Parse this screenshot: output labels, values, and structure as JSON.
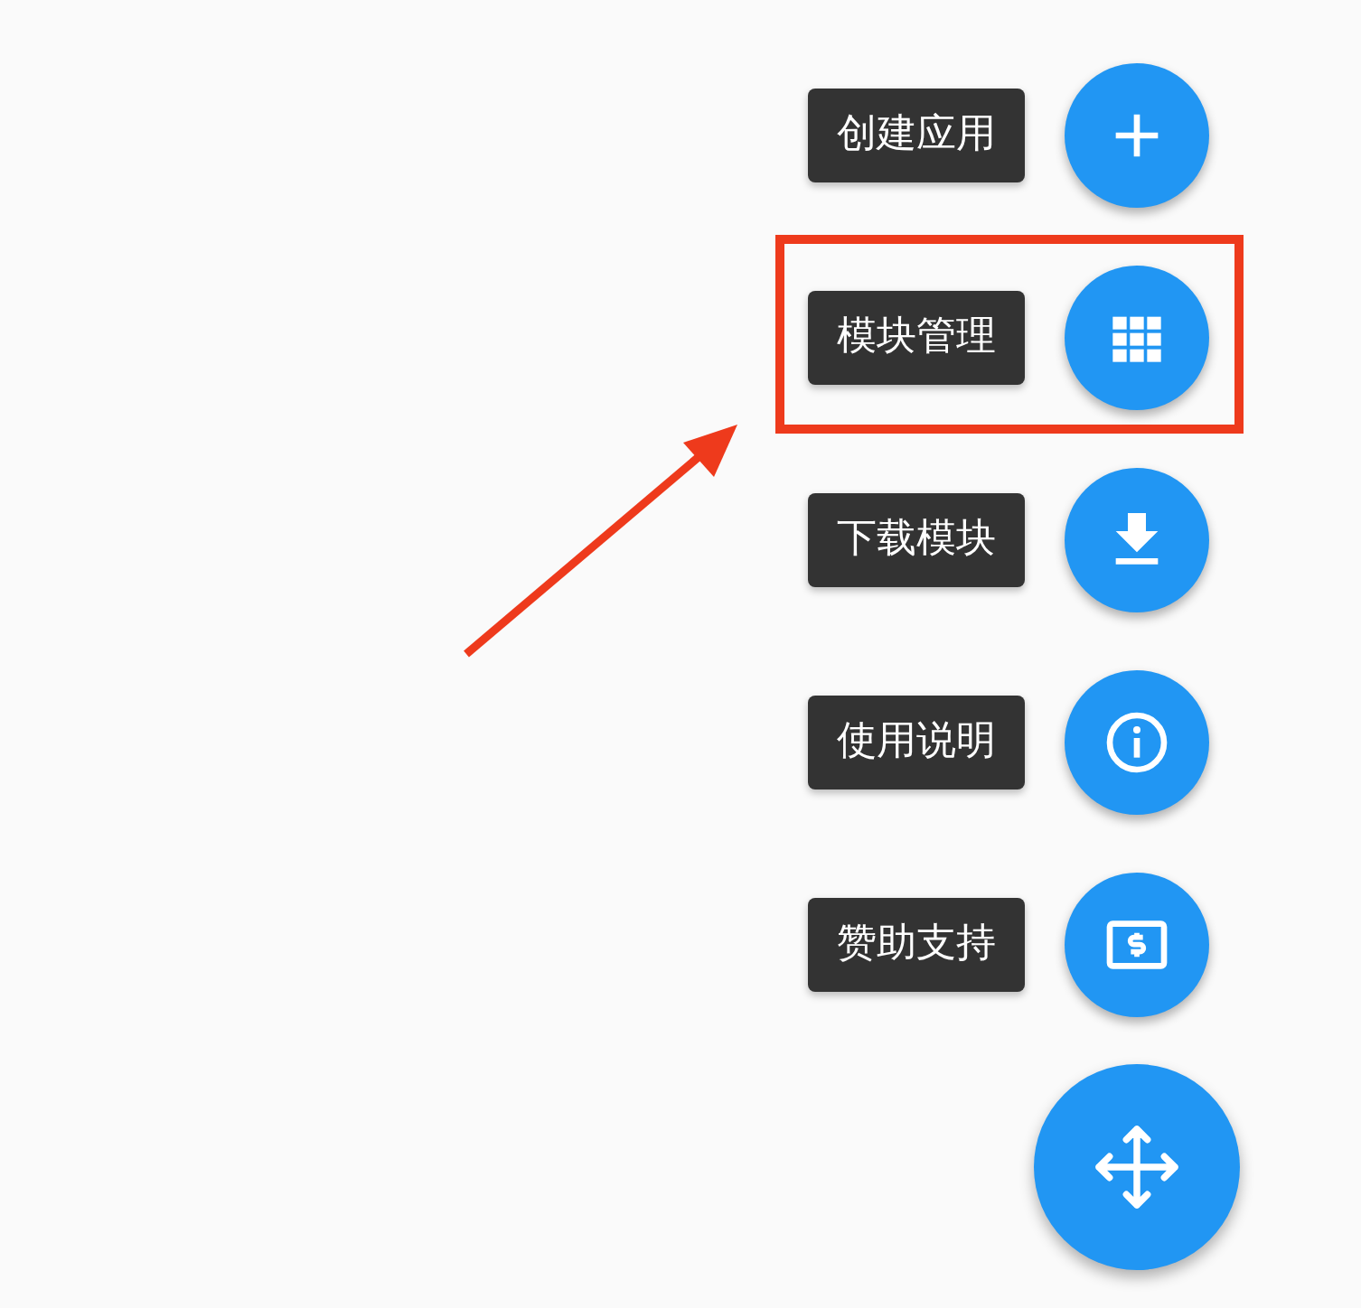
{
  "speed_dial": {
    "items": [
      {
        "label": "创建应用",
        "highlighted": false
      },
      {
        "label": "模块管理",
        "highlighted": true
      },
      {
        "label": "下载模块",
        "highlighted": false
      },
      {
        "label": "使用说明",
        "highlighted": false
      },
      {
        "label": "赞助支持",
        "highlighted": false
      }
    ]
  }
}
